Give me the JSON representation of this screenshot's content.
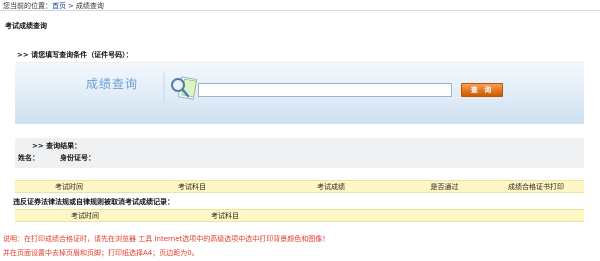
{
  "breadcrumb": {
    "prefix": "您当前的位置：",
    "home": "首页",
    "separator": ">",
    "current": "成绩查询"
  },
  "section_title": "考试成绩查询",
  "prompt": ">> 请您填写查询条件（证件号码）：",
  "query_panel": {
    "title": "成绩查询",
    "input_value": "",
    "button_label": "查 询"
  },
  "results": {
    "header": ">> 查询结果：",
    "name_label": "姓名：",
    "id_label": "身份证号："
  },
  "exam_table": {
    "columns": [
      "考试时间",
      "考试科目",
      "考试成绩",
      "是否通过",
      "成绩合格证书打印"
    ]
  },
  "violation": {
    "title": "违反证券法律法规或自律规则被取消考试成绩记录：",
    "columns": [
      "考试时间",
      "考试科目"
    ]
  },
  "notes": [
    "说明：在打印成绩合格证时，请先在浏览器 工具 Internet选项中的高级选项中选中打印背景颜色和图像！",
    "并在页面设置中去掉页眉和页脚；打印纸选择A4；页边距为0。"
  ],
  "colors": {
    "accent_blue": "#6aa0d6",
    "button_orange": "#e27318",
    "table_header_bg": "#fff6c6",
    "note_red": "#e33a2a"
  }
}
